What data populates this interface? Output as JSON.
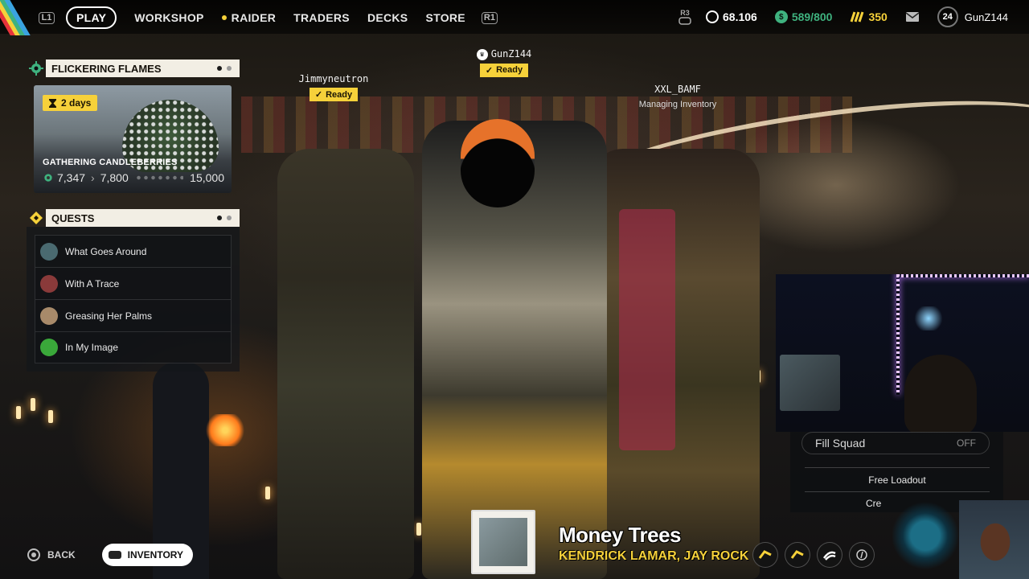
{
  "nav": {
    "left_bumper": "L1",
    "right_bumper": "R1",
    "items": [
      {
        "label": "PLAY",
        "active": true
      },
      {
        "label": "WORKSHOP"
      },
      {
        "label": "RAIDER",
        "has_notification": true
      },
      {
        "label": "TRADERS"
      },
      {
        "label": "DECKS"
      },
      {
        "label": "STORE"
      }
    ]
  },
  "stats": {
    "stick_hint": "R3",
    "coins": "68.106",
    "capacity": "589/800",
    "tokens": "350",
    "player_level": "24",
    "player_name": "GunZ144"
  },
  "event": {
    "title": "FLICKERING FLAMES",
    "time_left": "2 days",
    "name": "GATHERING CANDLEBERRIES",
    "current": "7,347",
    "next_milestone": "7,800",
    "goal": "15,000"
  },
  "quests": {
    "title": "QUESTS",
    "items": [
      {
        "label": "What Goes Around",
        "avatar_color": "#4a6a70"
      },
      {
        "label": "With A Trace",
        "avatar_color": "#8a3a3a"
      },
      {
        "label": "Greasing Her Palms",
        "avatar_color": "#a88a6a"
      },
      {
        "label": "In My Image",
        "avatar_color": "#3aa83a"
      }
    ]
  },
  "squad": [
    {
      "name": "Jimmyneutron",
      "status": "Ready"
    },
    {
      "name": "GunZ144",
      "status": "Ready",
      "leader": true
    },
    {
      "name": "XXL_BAMF",
      "status": "Managing Inventory"
    }
  ],
  "side_menu": {
    "fill_squad_label": "Fill Squad",
    "fill_squad_value": "OFF",
    "free_loadout": "Free Loadout",
    "partial_item": "Cre"
  },
  "bottom": {
    "back": "BACK",
    "inventory": "INVENTORY"
  },
  "now_playing": {
    "song": "Money Trees",
    "artist": "KENDRICK LAMAR, JAY ROCK"
  },
  "colors": {
    "accent_yellow": "#f6d13a",
    "accent_green": "#3fb27f",
    "panel_header": "#f2eee4"
  }
}
